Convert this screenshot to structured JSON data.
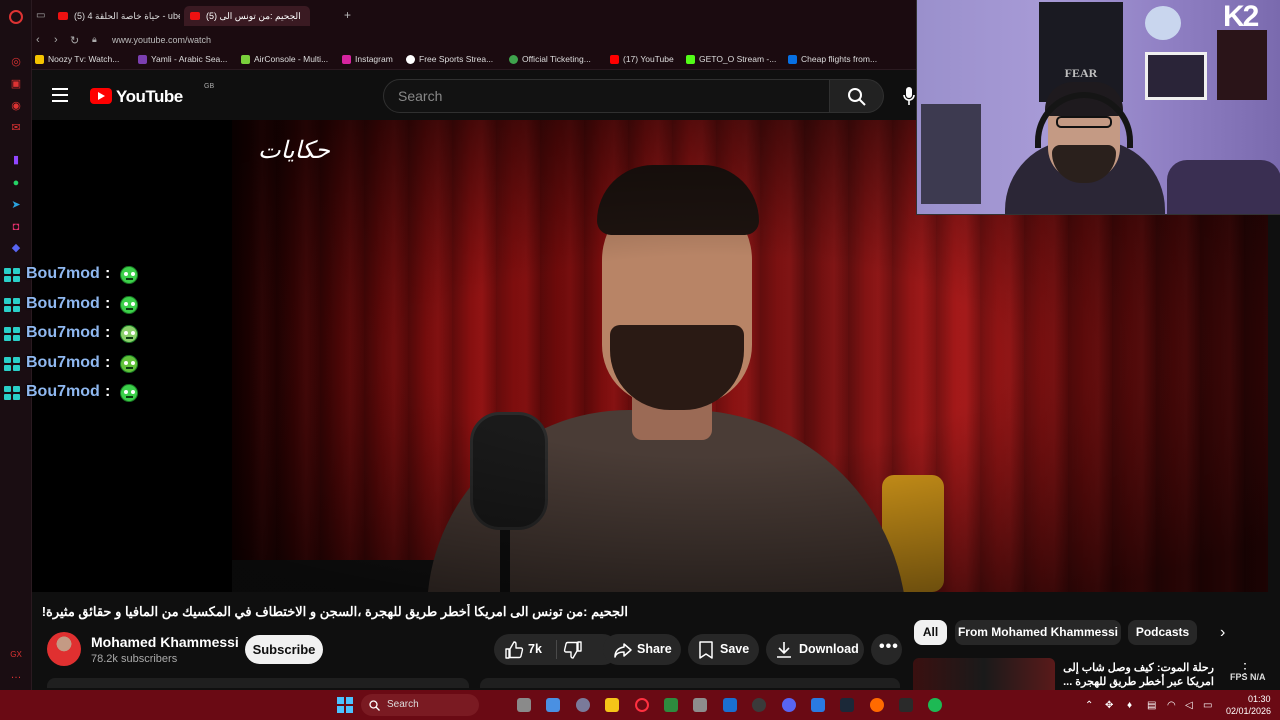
{
  "browser": {
    "tabs": [
      {
        "label": "(5) حياة خاصة الحلقة 4 - ube",
        "active": false
      },
      {
        "label": "(5) الجحيم :من تونس الى",
        "active": true
      }
    ],
    "new_tab": "+",
    "url": "www.youtube.com/watch",
    "bookmarks": [
      {
        "label": "Noozy Tv: Watch...",
        "color": "#f5c400"
      },
      {
        "label": "Yamli - Arabic Sea...",
        "color": "#7b3fb0"
      },
      {
        "label": "AirConsole - Multi...",
        "color": "#7ad03c"
      },
      {
        "label": "Instagram",
        "color": "#d6249f"
      },
      {
        "label": "Free Sports Strea...",
        "color": "#ffffff"
      },
      {
        "label": "Official Ticketing...",
        "color": "#3fa34d"
      },
      {
        "label": "(17) YouTube",
        "color": "#ff0000"
      },
      {
        "label": "GETO_O Stream -...",
        "color": "#53fc18"
      },
      {
        "label": "Cheap flights from...",
        "color": "#0770e3"
      }
    ]
  },
  "youtube": {
    "logo_text": "YouTube",
    "country_code": "GB",
    "search_placeholder": "Search",
    "video": {
      "watermark": "حكايات",
      "title": "الجحيم :من تونس الى امريكا أخطر طريق للهجرة ،السجن و الاختطاف في المكسيك من المافيا و حقائق مثيرة!"
    },
    "channel": {
      "name": "Mohamed Khammessi",
      "subscribers": "78.2k subscribers",
      "subscribe_label": "Subscribe"
    },
    "actions": {
      "like_count": "7k",
      "share_label": "Share",
      "save_label": "Save",
      "download_label": "Download"
    },
    "chips": [
      {
        "label": "All",
        "active": true
      },
      {
        "label": "From Mohamed Khammessi",
        "active": false
      },
      {
        "label": "Podcasts",
        "active": false
      }
    ],
    "recommendation_title": "رحلة الموت: كيف وصل شاب إلى امريكا عبر أخطر طريق للهجرة ... مافيا ، حدود و..."
  },
  "chat": [
    {
      "user": "Bou7mod",
      "sep": ":"
    },
    {
      "user": "Bou7mod",
      "sep": ":"
    },
    {
      "user": "Bou7mod",
      "sep": ":"
    },
    {
      "user": "Bou7mod",
      "sep": ":"
    },
    {
      "user": "Bou7mod",
      "sep": ":"
    }
  ],
  "webcam": {
    "poster_text": "FEAR",
    "overlay_logo": "K2"
  },
  "overlay": {
    "fps_label": "FPS N/A"
  },
  "taskbar": {
    "search_label": "Search",
    "time": "01:30",
    "date": "02/01/2026"
  },
  "colors": {
    "accent": "#ff0000",
    "taskbar": "#6a0a14",
    "chat_name": "#8fb8f0"
  }
}
